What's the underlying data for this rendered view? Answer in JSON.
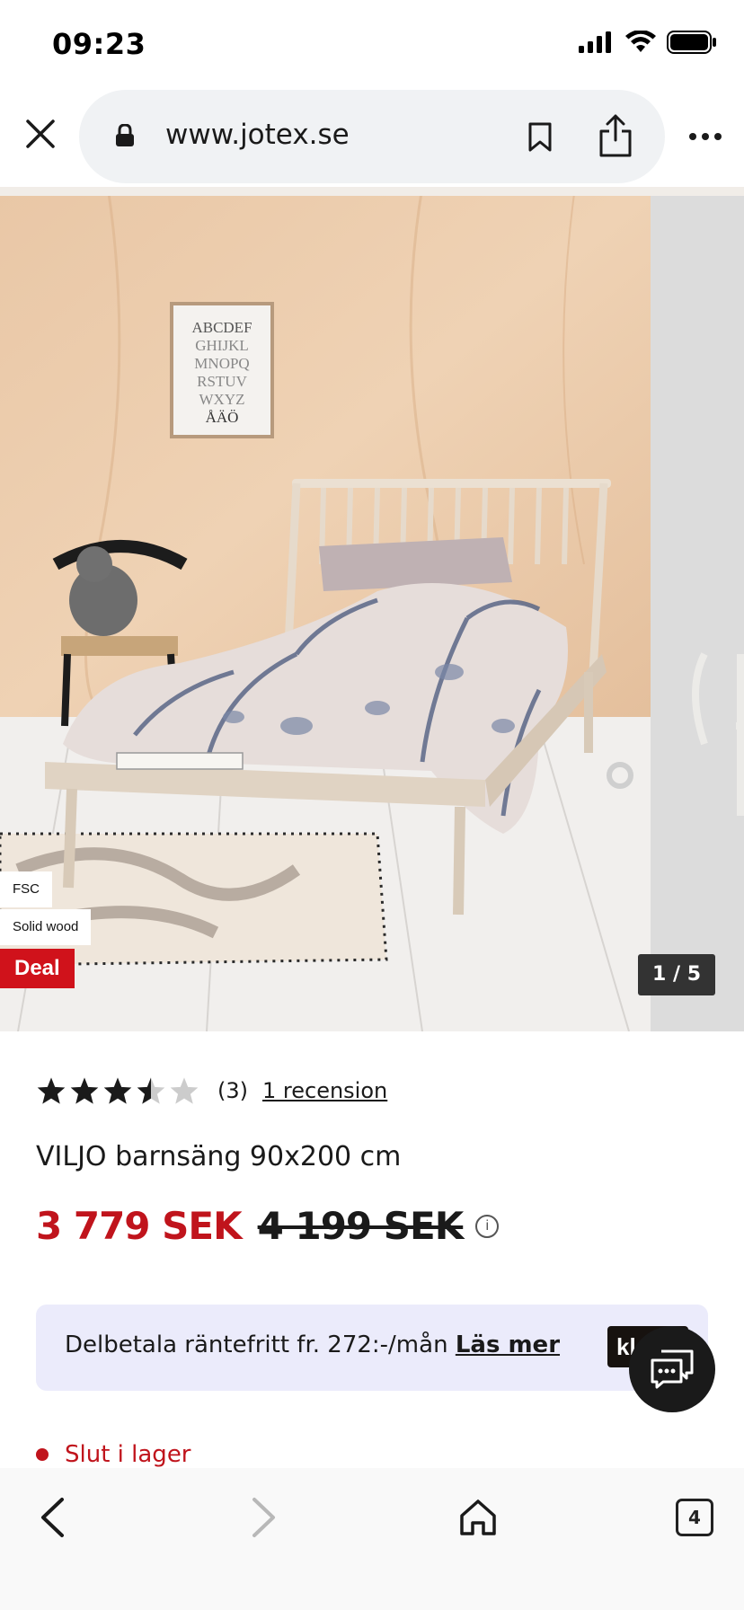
{
  "status_bar": {
    "time": "09:23"
  },
  "browser": {
    "url": "www.jotex.se",
    "tab_count": "4"
  },
  "gallery": {
    "badges": {
      "fsc": "FSC",
      "wood": "Solid wood",
      "deal": "Deal"
    },
    "counter": "1 / 5",
    "poster_lines": [
      "ABCDEF",
      "GHIJKL",
      "MNOPQ",
      "RSTUV",
      "WXYZ",
      "ÅÄÖ"
    ]
  },
  "product": {
    "rating": 3.5,
    "rating_count": "(3)",
    "review_link": "1 recension",
    "title": "VILJO barnsäng 90x200 cm",
    "price_current": "3 779 SEK",
    "price_old": "4 199 SEK",
    "info_icon": "i",
    "finance_text": "Delbetala räntefritt fr. 272:-/mån ",
    "finance_link": "Läs mer",
    "klarna_logo": "kl",
    "stock_status": "Slut i lager"
  },
  "colors": {
    "sale_red": "#c0141c",
    "deal_badge": "#d0121b",
    "finance_bg": "#ebebfb"
  },
  "icons": {
    "status": [
      "signal-icon",
      "wifi-icon",
      "battery-icon"
    ],
    "browser": [
      "close-icon",
      "lock-icon",
      "bookmark-icon",
      "share-icon",
      "more-icon"
    ],
    "toolbar": [
      "back-icon",
      "forward-icon",
      "home-icon",
      "tabs-icon"
    ],
    "chat": "chat-icon"
  }
}
